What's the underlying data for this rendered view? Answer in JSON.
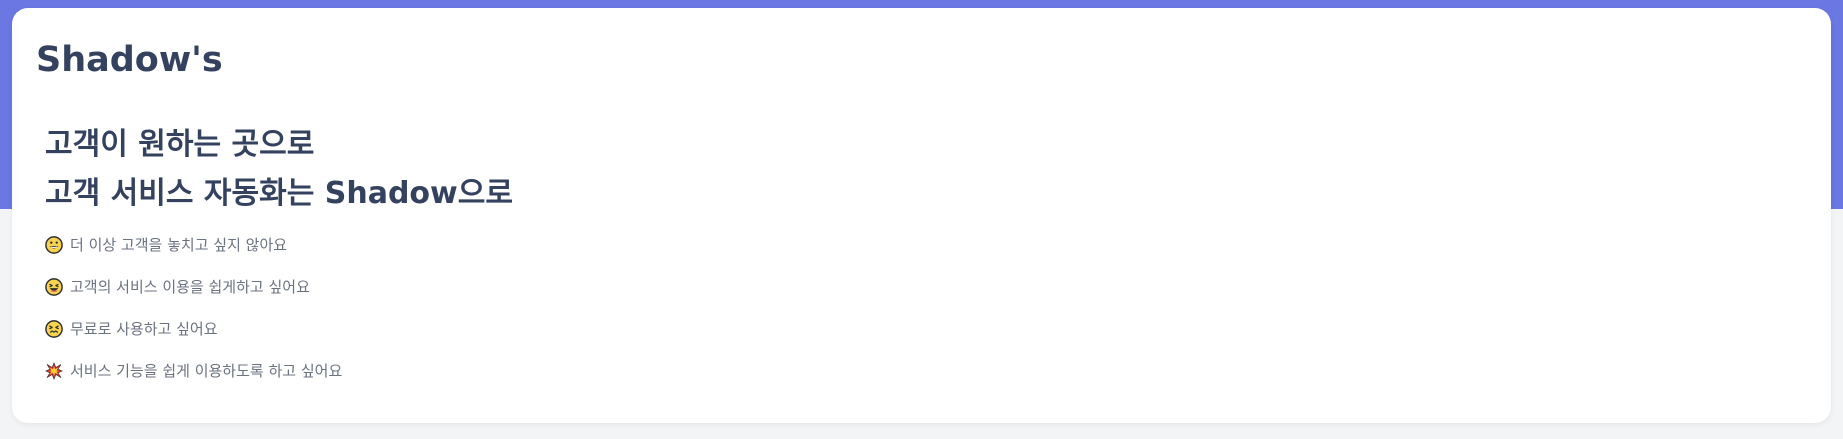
{
  "brand": {
    "name": "Shadow's"
  },
  "hero": {
    "headline_line_1": "고객이 원하는 곳으로",
    "headline_line_2": "고객 서비스 자동화는 Shadow으로"
  },
  "benefits": [
    {
      "icon": "smiling-face-icon",
      "text": "더 이상 고객을 놓치고 싶지 않아요"
    },
    {
      "icon": "laughing-face-icon",
      "text": "고객의 서비스 이용을 쉽게하고 싶어요"
    },
    {
      "icon": "confounded-face-icon",
      "text": "무료로 사용하고 싶어요"
    },
    {
      "icon": "collision-icon",
      "text": "서비스 기능을 쉽게 이용하도록 하고 싶어요"
    }
  ],
  "colors": {
    "hero_background": "#6b77e2",
    "page_background": "#f3f4f6",
    "card_background": "#ffffff",
    "primary_text": "#34425f",
    "secondary_text": "#6b7280"
  }
}
